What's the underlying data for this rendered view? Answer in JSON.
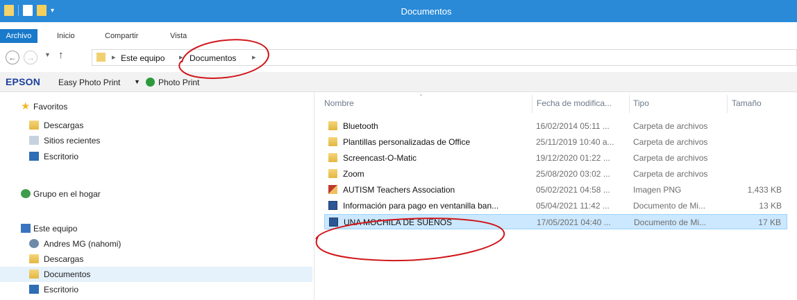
{
  "window": {
    "title": "Documentos"
  },
  "ribbon": {
    "tabs": [
      "Archivo",
      "Inicio",
      "Compartir",
      "Vista"
    ]
  },
  "address": {
    "path": [
      "Este equipo",
      "Documentos"
    ]
  },
  "epson": {
    "brand": "EPSON",
    "item1": "Easy Photo Print",
    "item2": "Photo Print"
  },
  "nav": {
    "favorites": "Favoritos",
    "fav_items": [
      "Descargas",
      "Sitios recientes",
      "Escritorio"
    ],
    "homegroup": "Grupo en el hogar",
    "thispc": "Este equipo",
    "pc_items": [
      "Andres MG (nahomi)",
      "Descargas",
      "Documentos",
      "Escritorio"
    ]
  },
  "columns": {
    "name": "Nombre",
    "date": "Fecha de modifica...",
    "type": "Tipo",
    "size": "Tamaño"
  },
  "files": [
    {
      "name": "Bluetooth",
      "date": "16/02/2014 05:11 ...",
      "type": "Carpeta de archivos",
      "size": "",
      "icon": "folder-icon"
    },
    {
      "name": "Plantillas personalizadas de Office",
      "date": "25/11/2019 10:40 a...",
      "type": "Carpeta de archivos",
      "size": "",
      "icon": "folder-icon"
    },
    {
      "name": "Screencast-O-Matic",
      "date": "19/12/2020 01:22 ...",
      "type": "Carpeta de archivos",
      "size": "",
      "icon": "folder-icon"
    },
    {
      "name": "Zoom",
      "date": "25/08/2020 03:02 ...",
      "type": "Carpeta de archivos",
      "size": "",
      "icon": "folder-icon"
    },
    {
      "name": "AUTISM Teachers Association",
      "date": "05/02/2021 04:58 ...",
      "type": "Imagen PNG",
      "size": "1,433 KB",
      "icon": "png-image-icon"
    },
    {
      "name": "Información para pago en ventanilla ban...",
      "date": "05/04/2021 11:42 ...",
      "type": "Documento de Mi...",
      "size": "13 KB",
      "icon": "word-document-icon"
    },
    {
      "name": "UNA MOCHILA DE SUEÑOS",
      "date": "17/05/2021 04:40 ...",
      "type": "Documento de Mi...",
      "size": "17 KB",
      "icon": "word-document-icon"
    }
  ],
  "colors": {
    "titlebar": "#2a8ad8",
    "annotation": "#d0161a",
    "selection": "#cce8ff"
  }
}
